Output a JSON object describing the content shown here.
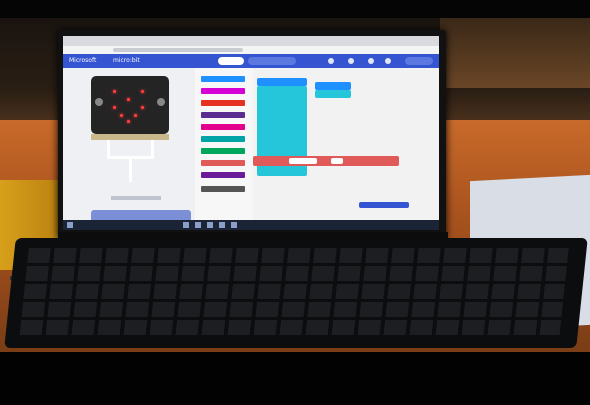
{
  "scene": {
    "description_items": [
      "monitor",
      "keyboard",
      "desk",
      "makecode-editor"
    ]
  },
  "editor": {
    "header_logo": "Microsoft",
    "header_logo2": "micro:bit"
  },
  "colors": {
    "makecode_header": "#3454d1",
    "block_cyan": "#26c6da",
    "block_red": "#e05a5a",
    "led_red": "#ff3b3b",
    "desk_orange": "#c86a2a"
  }
}
